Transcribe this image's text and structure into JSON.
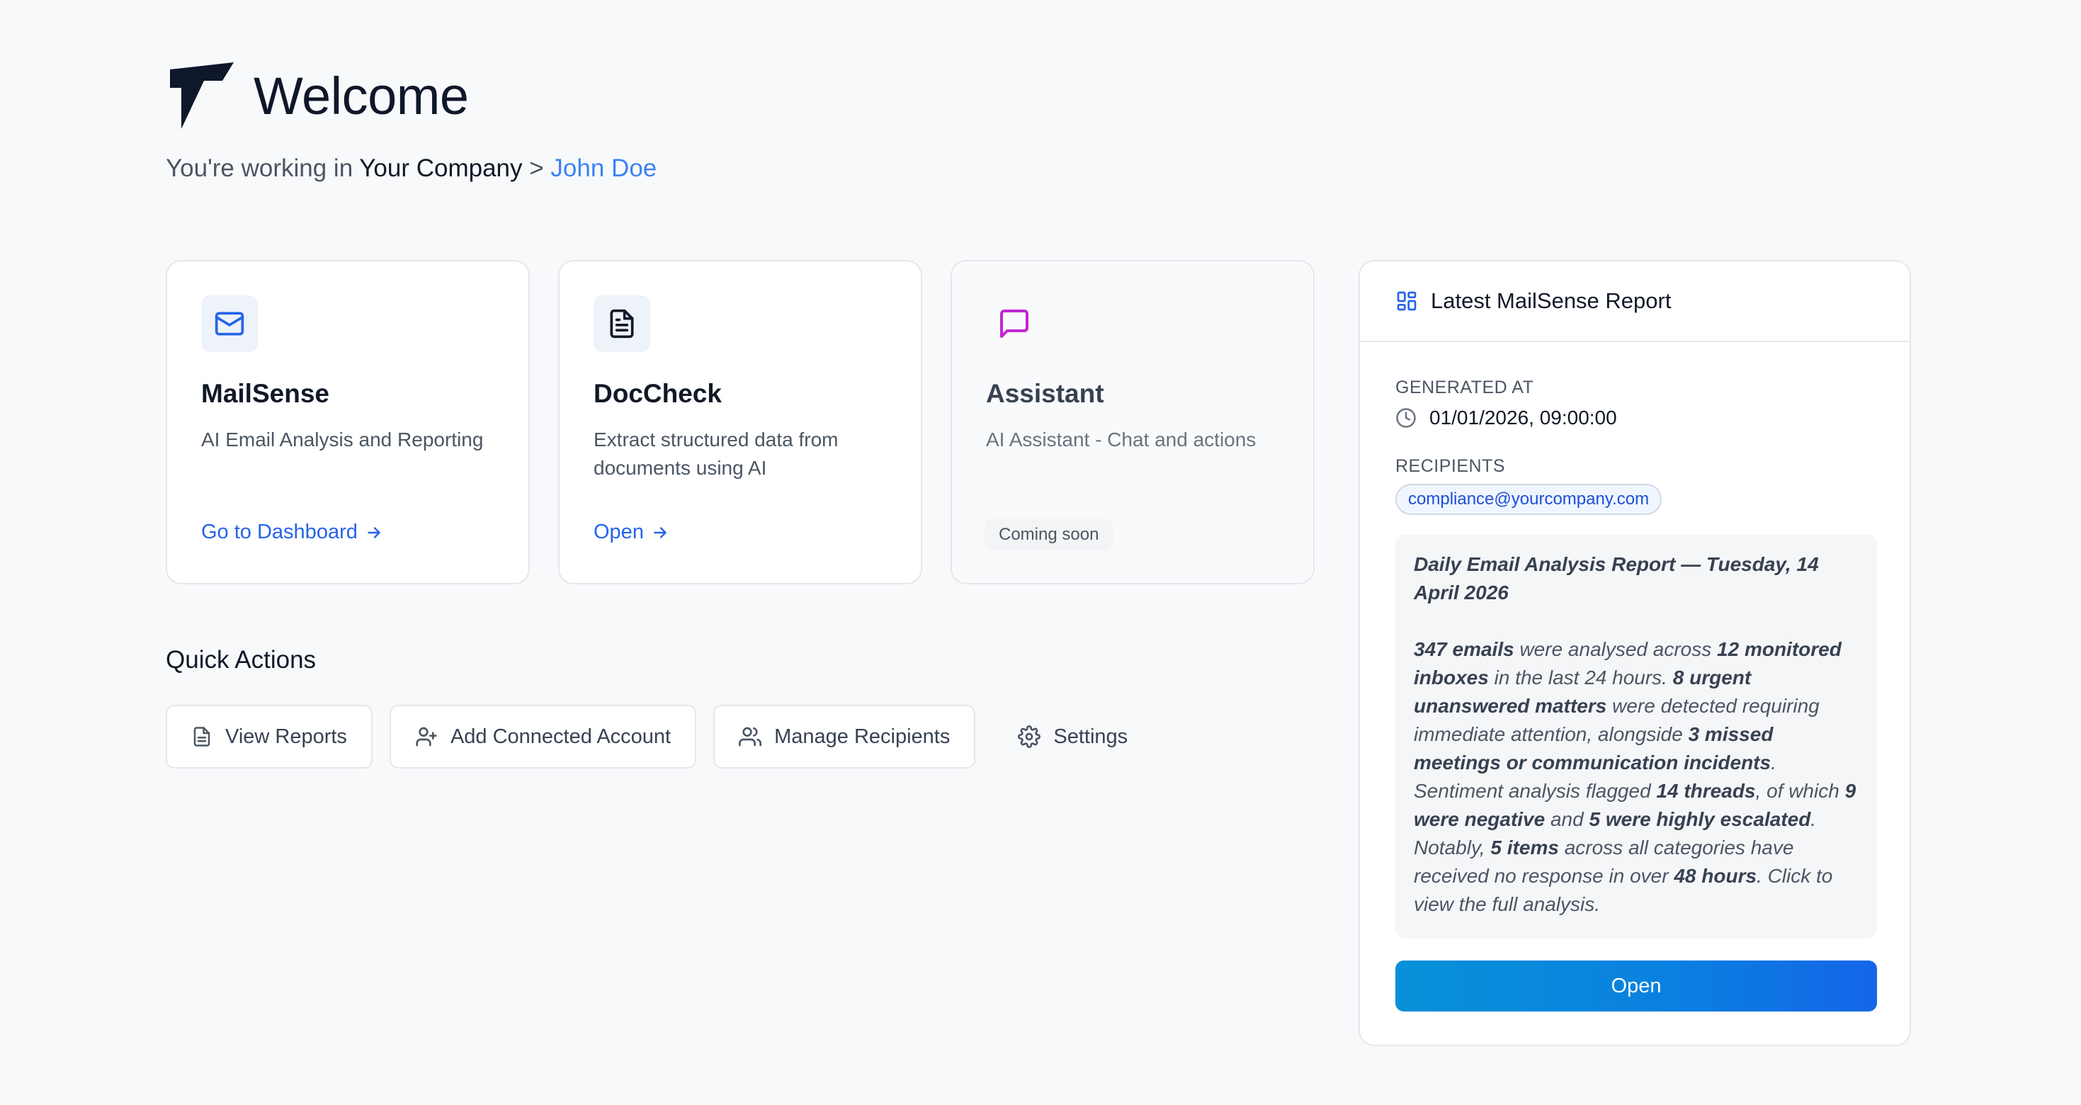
{
  "header": {
    "title": "Welcome",
    "subtitle_prefix": "You're working in",
    "company": "Your Company",
    "separator": ">",
    "user": "John Doe"
  },
  "cards": [
    {
      "icon": "mail-icon",
      "title": "MailSense",
      "description": "AI Email Analysis and Reporting",
      "link_label": "Go to Dashboard"
    },
    {
      "icon": "document-icon",
      "title": "DocCheck",
      "description": "Extract structured data from documents using AI",
      "link_label": "Open"
    },
    {
      "icon": "chat-icon",
      "title": "Assistant",
      "description": "AI Assistant - Chat and actions",
      "badge": "Coming soon"
    }
  ],
  "quick_actions": {
    "title": "Quick Actions",
    "items": [
      {
        "icon": "file-icon",
        "label": "View Reports"
      },
      {
        "icon": "user-plus-icon",
        "label": "Add Connected Account"
      },
      {
        "icon": "users-icon",
        "label": "Manage Recipients"
      },
      {
        "icon": "gear-icon",
        "label": "Settings"
      }
    ]
  },
  "report": {
    "title": "Latest MailSense Report",
    "generated_label": "GENERATED AT",
    "generated_value": "01/01/2026, 09:00:00",
    "recipients_label": "RECIPIENTS",
    "recipients": [
      "compliance@yourcompany.com"
    ],
    "summary_title": "Daily Email Analysis Report — Tuesday, 14 April 2026",
    "summary": {
      "emails": "347 emails",
      "t1": " were analysed across ",
      "inboxes": "12 monitored inboxes",
      "t2": " in the last 24 hours. ",
      "urgent": "8 urgent unanswered matters",
      "t3": " were detected requiring immediate attention, alongside ",
      "missed": "3 missed meetings or communication incidents",
      "t4": ". Sentiment analysis flagged ",
      "threads": "14 threads",
      "t5": ", of which ",
      "negative": "9 were negative",
      "t6": " and ",
      "escalated": "5 were highly escalated",
      "t7": ". Notably, ",
      "items": "5 items",
      "t8": " across all categories have received no response in over ",
      "hours": "48 hours",
      "t9": ". Click to view the full analysis."
    },
    "open_label": "Open"
  },
  "colors": {
    "accent": "#2563eb",
    "user_link": "#3b82f6",
    "assistant_icon": "#c026d3",
    "button_gradient_start": "#0891d8",
    "button_gradient_end": "#1565e8"
  }
}
